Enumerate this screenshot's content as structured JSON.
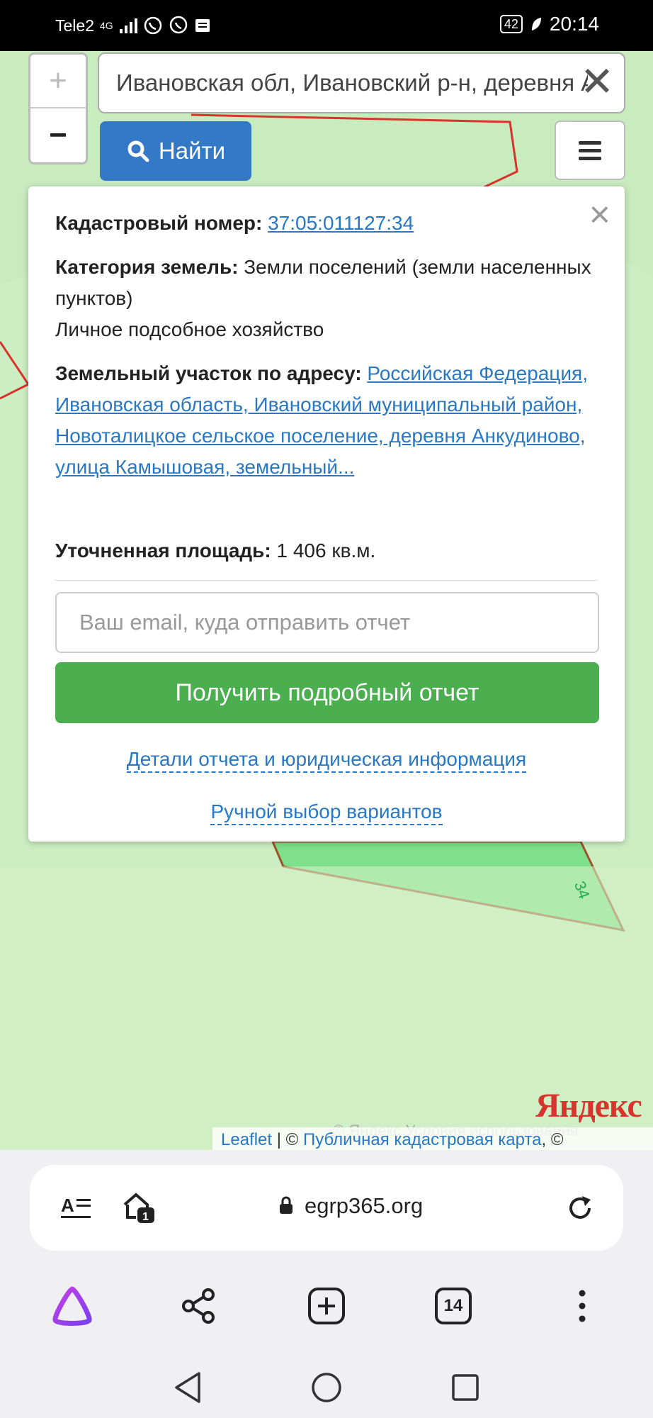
{
  "status_bar": {
    "carrier": "Tele2",
    "network": "4G",
    "battery": "42",
    "time": "20:14"
  },
  "map": {
    "zoom_in": "+",
    "zoom_out": "−",
    "parcel_label": "34",
    "provider_logo": "Яндекс",
    "attribution_leaflet": "Leaflet",
    "attribution_sep": " | © ",
    "attribution_source": "Публичная кадастровая карта",
    "attribution_tail": ", ©",
    "attribution_ghost": "© Яндекс  Условия использования"
  },
  "search": {
    "value": "Ивановская обл, Ивановский р-н, деревня Анкудиново",
    "clear_icon": "close-icon",
    "find_label": "Найти"
  },
  "popup": {
    "cadastral_label": "Кадастровый номер:",
    "cadastral_value": "37:05:011127:34",
    "category_label": "Категория земель:",
    "category_value": "Земли поселений (земли населенных пунктов)",
    "use_value": "Личное подсобное хозяйство",
    "address_label": "Земельный участок по адресу:",
    "address_value": "Российская Федерация, Ивановская область, Ивановский муниципальный район, Новоталицкое сельское поселение, деревня Анкудиново, улица Камышовая, земельный...",
    "area_label": "Уточненная площадь:",
    "area_value": "1 406 кв.м.",
    "email_placeholder": "Ваш email, куда отправить отчет",
    "report_button": "Получить подробный отчет",
    "details_link": "Детали отчета и юридическая информация",
    "manual_link": "Ручной выбор вариантов"
  },
  "browser": {
    "url": "egrp365.org",
    "tabs_count": "14",
    "reader_badge": "1"
  },
  "colors": {
    "find_button": "#3379c6",
    "report_button": "#4bae4f",
    "link": "#2878c4",
    "map_bg": "#cdeec3",
    "parcel_fill": "#7ee08a",
    "boundary": "#d9342b"
  }
}
